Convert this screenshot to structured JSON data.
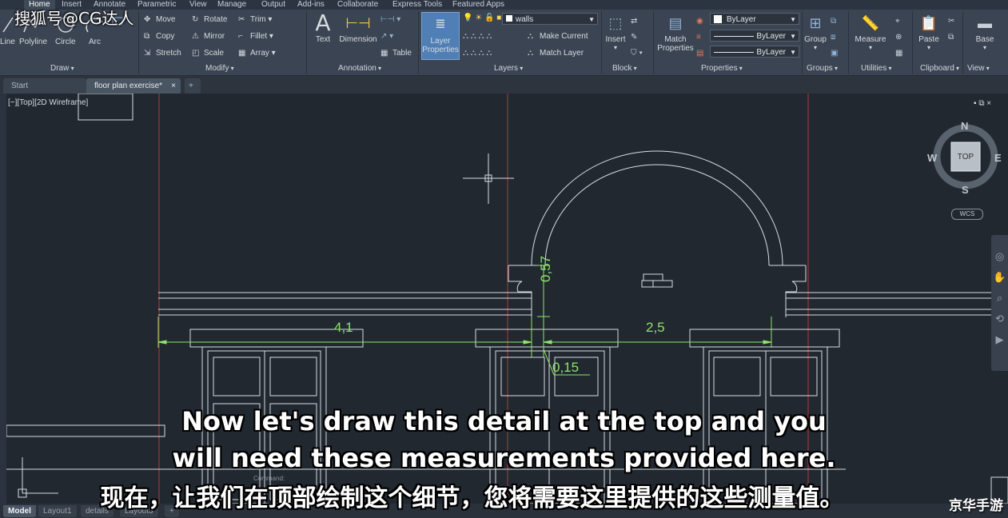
{
  "menu": {
    "items": [
      "Home",
      "Insert",
      "Annotate",
      "Parametric",
      "View",
      "Manage",
      "Output",
      "Add-ins",
      "Collaborate",
      "Express Tools",
      "Featured Apps"
    ]
  },
  "ribbon": {
    "draw": {
      "title": "Draw",
      "line": "Line",
      "polyline": "Polyline",
      "circle": "Circle",
      "arc": "Arc"
    },
    "modify": {
      "title": "Modify",
      "move": "Move",
      "rotate": "Rotate",
      "trim": "Trim",
      "copy": "Copy",
      "mirror": "Mirror",
      "fillet": "Fillet",
      "stretch": "Stretch",
      "scale": "Scale",
      "array": "Array"
    },
    "annotation": {
      "title": "Annotation",
      "text": "Text",
      "dimension": "Dimension",
      "table": "Table"
    },
    "layers": {
      "title": "Layers",
      "layer_properties_1": "Layer",
      "layer_properties_2": "Properties",
      "current_layer": "walls",
      "make_current": "Make Current",
      "match_layer": "Match Layer"
    },
    "block": {
      "title": "Block",
      "insert": "Insert"
    },
    "properties": {
      "title": "Properties",
      "match_1": "Match",
      "match_2": "Properties",
      "color": "ByLayer",
      "linetype": "ByLayer",
      "lineweight": "ByLayer"
    },
    "groups": {
      "title": "Groups",
      "group": "Group"
    },
    "utilities": {
      "title": "Utilities",
      "measure": "Measure"
    },
    "clipboard": {
      "title": "Clipboard",
      "paste": "Paste"
    },
    "view": {
      "title": "View",
      "base": "Base"
    }
  },
  "file_tabs": {
    "start": "Start",
    "active": "floor plan exercise*",
    "close": "×",
    "add": "+"
  },
  "viewport": {
    "label": "[−][Top][2D Wireframe]",
    "controls": "▪ ⧉ ×",
    "command_hint": "Command:"
  },
  "viewcube": {
    "top": "TOP",
    "n": "N",
    "s": "S",
    "e": "E",
    "w": "W",
    "wcs": "WCS"
  },
  "drawing": {
    "dim_left": "4,1",
    "dim_right": "2,5",
    "dim_vertical": "0,57",
    "dim_small": "0,15",
    "colors": {
      "lines": "#d9dde2",
      "dimensions": "#8fe36a",
      "red_lines": "#b33b3b",
      "background": "#212830"
    }
  },
  "layout_tabs": [
    "Model",
    "Layout1",
    "details",
    "Layout3"
  ],
  "layout_add": "+",
  "subtitles": {
    "en_line1": "Now let's draw this detail at the top and you",
    "en_line2": "will need these measurements provided here.",
    "cn": "现在，让我们在顶部绘制这个细节，您将需要这里提供的这些测量值。"
  },
  "watermarks": {
    "top_left": "搜狐号@CG达人",
    "bottom_right": "京华手游"
  }
}
